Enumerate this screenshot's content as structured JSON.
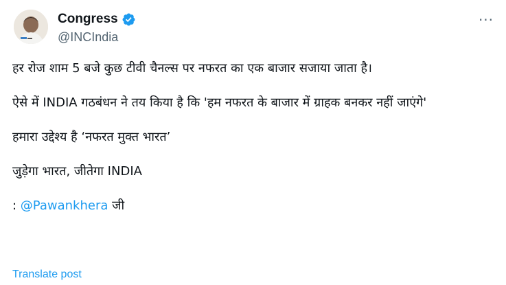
{
  "author": {
    "display_name": "Congress",
    "handle": "@INCIndia",
    "verified": true,
    "avatar_icon": "profile-photo"
  },
  "menu": {
    "more_label": "···"
  },
  "tweet": {
    "paragraphs": [
      "हर रोज शाम 5 बजे कुछ टीवी चैनल्स पर नफरत का एक बाजार सजाया जाता है।",
      "ऐसे में INDIA गठबंधन ने तय किया है कि 'हम नफरत के बाजार में ग्राहक बनकर नहीं जाएंगे'",
      "हमारा उद्देश्य है ‘नफरत मुक्त भारत’",
      "जुड़ेगा भारत, जीतेगा INDIA"
    ],
    "credit_prefix": ": ",
    "credit_mention": "@Pawankhera",
    "credit_suffix": " जी"
  },
  "translate_label": "Translate post",
  "colors": {
    "text": "#0f1419",
    "secondary": "#536471",
    "link": "#1d9bf0",
    "verified_badge": "#1d9bf0"
  }
}
